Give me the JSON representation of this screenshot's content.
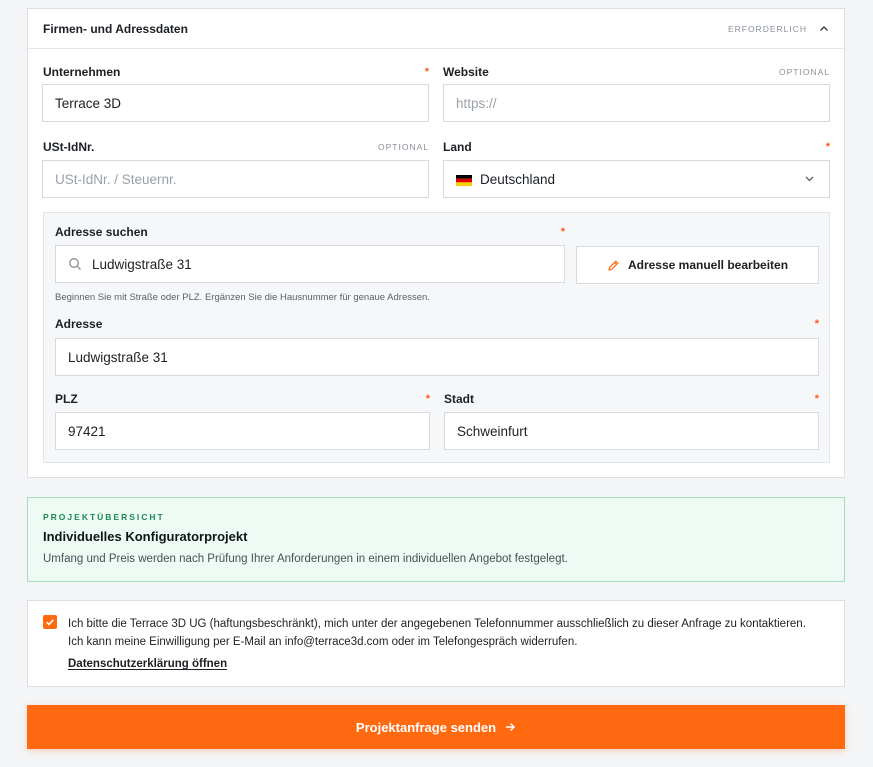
{
  "firm_section": {
    "title": "Firmen- und Adressdaten",
    "required_tag": "ERFORDERLICH"
  },
  "fields": {
    "company": {
      "label": "Unternehmen",
      "value": "Terrace 3D"
    },
    "website": {
      "label": "Website",
      "tag": "OPTIONAL",
      "placeholder": "https://"
    },
    "vat": {
      "label": "USt-IdNr.",
      "tag": "OPTIONAL",
      "placeholder": "USt-IdNr. / Steuernr."
    },
    "country": {
      "label": "Land",
      "value": "Deutschland"
    },
    "address_search": {
      "label": "Adresse suchen",
      "value": "Ludwigstraße 31",
      "hint": "Beginnen Sie mit Straße oder PLZ. Ergänzen Sie die Hausnummer für genaue Adressen."
    },
    "manual_edit": {
      "label": "Adresse manuell bearbeiten"
    },
    "address": {
      "label": "Adresse",
      "value": "Ludwigstraße 31"
    },
    "zip": {
      "label": "PLZ",
      "value": "97421"
    },
    "city": {
      "label": "Stadt",
      "value": "Schweinfurt"
    }
  },
  "required_marker": "*",
  "overview": {
    "kicker": "PROJEKTÜBERSICHT",
    "title": "Individuelles Konfiguratorprojekt",
    "text": "Umfang und Preis werden nach Prüfung Ihrer Anforderungen in einem individuellen Angebot festgelegt."
  },
  "consent": {
    "checked": true,
    "line1": "Ich bitte die Terrace 3D UG (haftungsbeschränkt), mich unter der angegebenen Telefonnummer ausschließlich zu dieser Anfrage zu kontaktieren.",
    "line2": "Ich kann meine Einwilligung per E-Mail an info@terrace3d.com oder im Telefongespräch widerrufen.",
    "link": "Datenschutzerklärung öffnen"
  },
  "submit": {
    "label": "Projektanfrage senden"
  },
  "icons": {
    "collapse": "chevron-up-icon",
    "dropdown": "chevron-down-icon",
    "search": "search-icon",
    "edit": "pencil-icon",
    "flag": "germany-flag-icon",
    "arrow": "arrow-right-icon",
    "check": "check-icon"
  },
  "colors": {
    "accent": "#ff6a10",
    "required": "#ff5a1f",
    "overview_bg": "#eefaf4",
    "overview_border": "#a8dcc1",
    "overview_kicker": "#1b8a54"
  }
}
